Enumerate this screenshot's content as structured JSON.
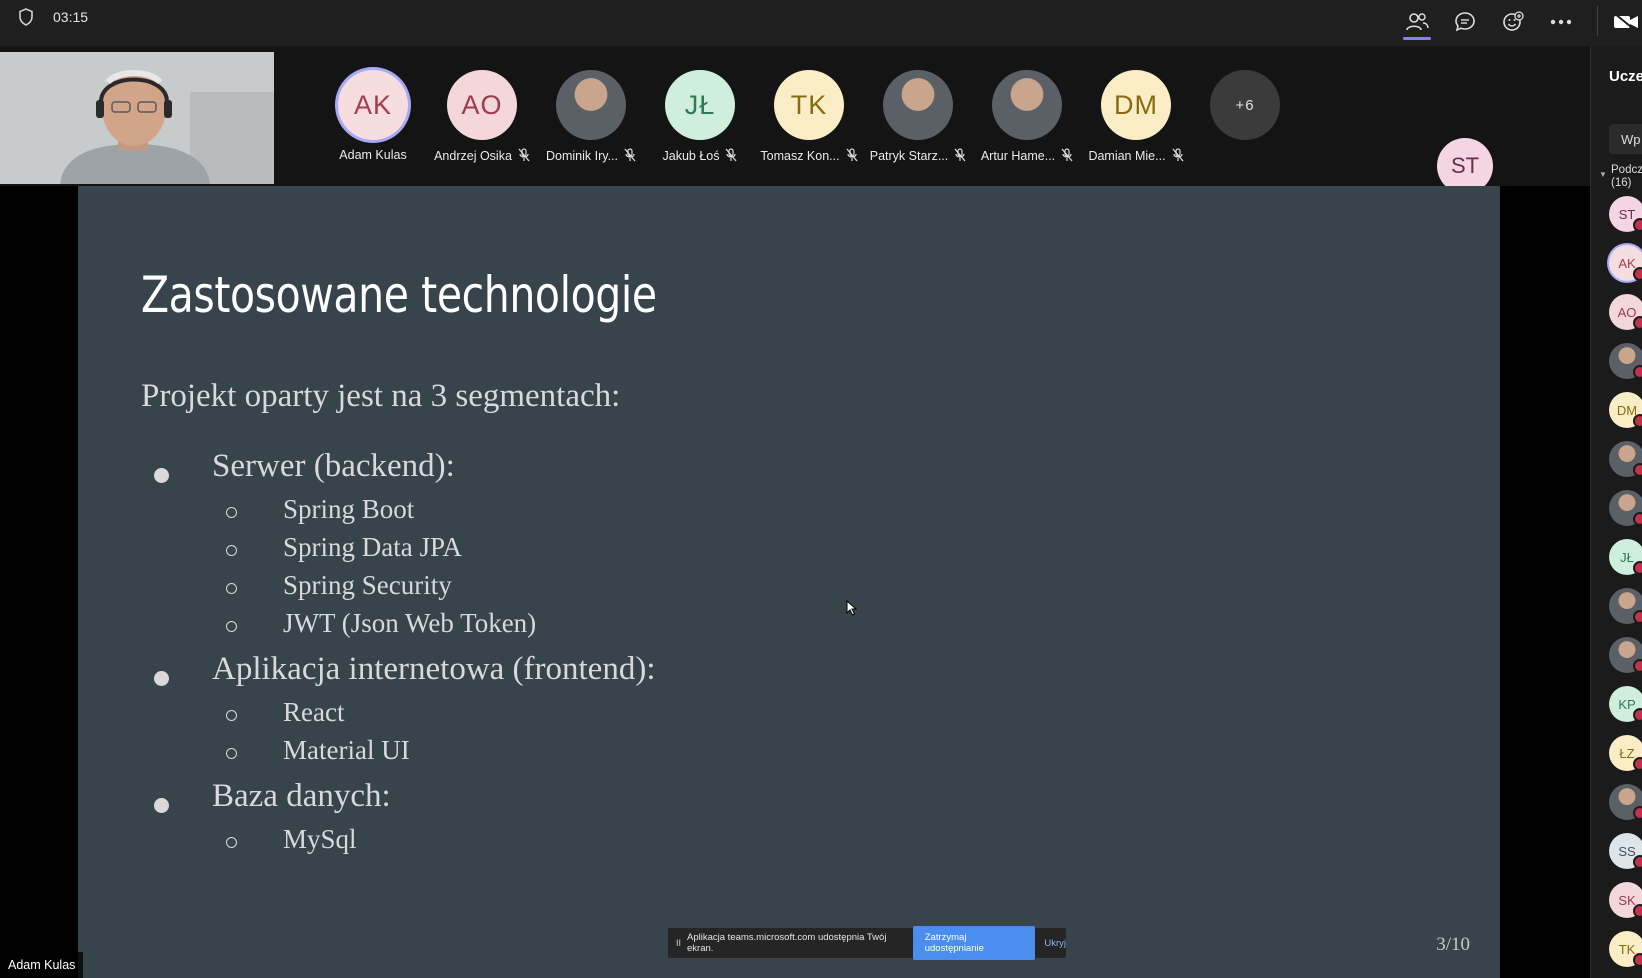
{
  "topbar": {
    "timer": "03:15",
    "icons": [
      "people-icon",
      "chat-icon",
      "react-icon",
      "more-icon",
      "camera-icon"
    ]
  },
  "self_video_label": "Adam Kulas",
  "participants": [
    {
      "initials": "AK",
      "name": "Adam Kulas",
      "bg": "#f6dde0",
      "fg": "#a13f4d",
      "muted": false,
      "speaking": true
    },
    {
      "initials": "AO",
      "name": "Andrzej Osika",
      "bg": "#f3d7db",
      "fg": "#9c3b4c",
      "muted": true
    },
    {
      "initials": "",
      "name": "Dominik Iry...",
      "photo": true,
      "muted": true
    },
    {
      "initials": "JŁ",
      "name": "Jakub Łoś",
      "bg": "#cfeede",
      "fg": "#2d7a55",
      "muted": true
    },
    {
      "initials": "TK",
      "name": "Tomasz Kon...",
      "bg": "#fbeec6",
      "fg": "#8a6a10",
      "muted": true
    },
    {
      "initials": "",
      "name": "Patryk Starz...",
      "photo": true,
      "muted": true
    },
    {
      "initials": "",
      "name": "Artur Hame...",
      "photo": true,
      "muted": true
    },
    {
      "initials": "DM",
      "name": "Damian Mie...",
      "bg": "#fbeec6",
      "fg": "#8a6a10",
      "muted": true
    }
  ],
  "overflow_count": "+6",
  "pinned_avatar": "ST",
  "slide": {
    "title": "Zastosowane technologie",
    "intro": "Projekt oparty jest na 3 segmentach:",
    "sections": [
      {
        "label": "Serwer (backend):",
        "items": [
          "Spring Boot",
          "Spring Data JPA",
          "Spring Security",
          "JWT (Json Web Token)"
        ]
      },
      {
        "label": "Aplikacja internetowa (frontend):",
        "items": [
          "React",
          "Material UI"
        ]
      },
      {
        "label": "Baza danych:",
        "items": [
          "MySql"
        ]
      }
    ],
    "page": "3/10"
  },
  "share_bar": {
    "pause": "II",
    "message": "Aplikacja teams.microsoft.com udostępnia Twój ekran.",
    "stop_label": "Zatrzymaj udostępnianie",
    "hide_label": "Ukryj"
  },
  "panel": {
    "title": "Ucze",
    "tab": "Wp",
    "section_line1": "Podcz",
    "section_line2": "(16)",
    "avatars": [
      {
        "initials": "ST",
        "bg": "#f3d5e3",
        "fg": "#6d2b4e"
      },
      {
        "initials": "AK",
        "bg": "#f6dde0",
        "fg": "#a13f4d",
        "ring": true
      },
      {
        "initials": "AO",
        "bg": "#f3d7db",
        "fg": "#9c3b4c"
      },
      {
        "initials": "",
        "photo": true
      },
      {
        "initials": "DM",
        "bg": "#fbeec6",
        "fg": "#8a6a10"
      },
      {
        "initials": "",
        "photo": true
      },
      {
        "initials": "",
        "photo": true
      },
      {
        "initials": "JŁ",
        "bg": "#cfeede",
        "fg": "#2d7a55"
      },
      {
        "initials": "",
        "photo": true
      },
      {
        "initials": "",
        "photo": true
      },
      {
        "initials": "KP",
        "bg": "#cfeede",
        "fg": "#2d7a55"
      },
      {
        "initials": "ŁZ",
        "bg": "#fbeec6",
        "fg": "#8a6a10"
      },
      {
        "initials": "",
        "photo": true
      },
      {
        "initials": "SS",
        "bg": "#dde5ea",
        "fg": "#44525c"
      },
      {
        "initials": "SK",
        "bg": "#f3d7db",
        "fg": "#9c3b4c"
      },
      {
        "initials": "TK",
        "bg": "#fbeec6",
        "fg": "#8a6a10"
      }
    ]
  }
}
